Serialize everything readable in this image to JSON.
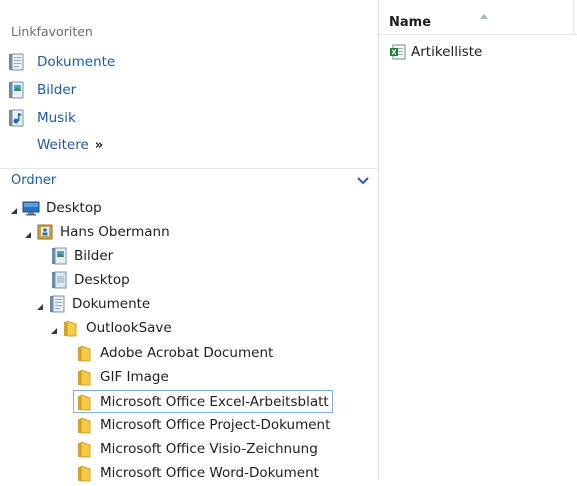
{
  "favorites": {
    "title": "Linkfavoriten",
    "items": [
      {
        "label": "Dokumente",
        "icon": "documents-library-icon"
      },
      {
        "label": "Bilder",
        "icon": "pictures-library-icon"
      },
      {
        "label": "Musik",
        "icon": "music-library-icon"
      }
    ],
    "more_label": "Weitere",
    "more_chevron": "»"
  },
  "folders": {
    "title": "Ordner",
    "tree": [
      {
        "label": "Desktop",
        "icon": "desktop-icon",
        "expanded": true
      },
      {
        "label": "Hans Obermann",
        "icon": "user-folder-icon",
        "expanded": true
      },
      {
        "label": "Bilder",
        "icon": "pictures-library-icon",
        "expanded": false
      },
      {
        "label": "Desktop",
        "icon": "desktop-library-icon",
        "expanded": false
      },
      {
        "label": "Dokumente",
        "icon": "documents-library-icon",
        "expanded": true
      },
      {
        "label": "OutlookSave",
        "icon": "folder-icon",
        "expanded": true
      },
      {
        "label": "Adobe Acrobat Document",
        "icon": "folder-icon",
        "expanded": false
      },
      {
        "label": "GIF Image",
        "icon": "folder-icon",
        "expanded": false
      },
      {
        "label": "Microsoft Office Excel-Arbeitsblatt",
        "icon": "folder-icon",
        "expanded": false,
        "selected": true
      },
      {
        "label": "Microsoft Office Project-Dokument",
        "icon": "folder-icon",
        "expanded": false
      },
      {
        "label": "Microsoft Office Visio-Zeichnung",
        "icon": "folder-icon",
        "expanded": false
      },
      {
        "label": "Microsoft Office Word-Dokument",
        "icon": "folder-icon",
        "expanded": false
      }
    ]
  },
  "file_list": {
    "columns": [
      {
        "label": "Name",
        "sorted": "ascending"
      }
    ],
    "files": [
      {
        "label": "Artikelliste",
        "icon": "excel-file-icon"
      }
    ]
  },
  "colors": {
    "link_blue": "#1e5aa8",
    "folder_yellow": "#e8b730",
    "selection_border": "#84acdd"
  }
}
